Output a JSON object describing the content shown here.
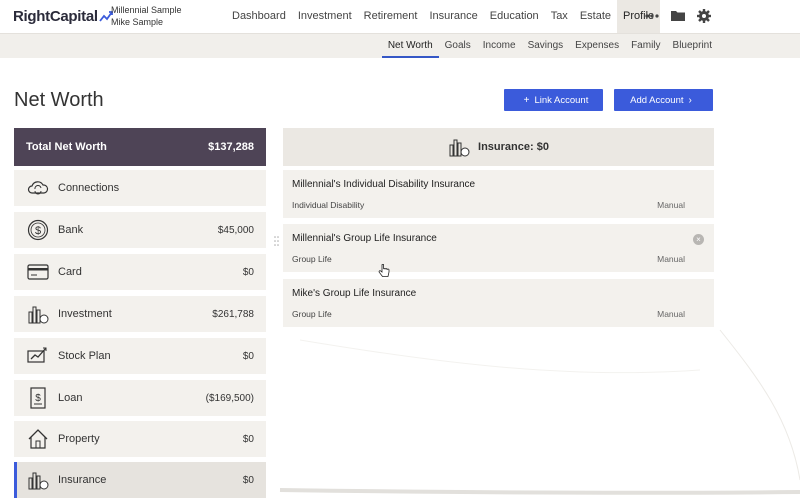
{
  "brand": {
    "name": "RightCapital",
    "accent": "#3b5bdb",
    "dark": "#4e4456"
  },
  "clients": {
    "line1": "Millennial Sample",
    "line2": "Mike Sample"
  },
  "main_nav": [
    "Dashboard",
    "Investment",
    "Retirement",
    "Insurance",
    "Education",
    "Tax",
    "Estate",
    "Profile"
  ],
  "main_nav_active": "Profile",
  "top_icons": [
    "more-icon",
    "folder-icon",
    "gear-icon"
  ],
  "sub_nav": [
    "Net Worth",
    "Goals",
    "Income",
    "Savings",
    "Expenses",
    "Family",
    "Blueprint"
  ],
  "sub_nav_active": "Net Worth",
  "page": {
    "title": "Net Worth",
    "link_account": "Link Account",
    "add_account": "Add Account"
  },
  "total": {
    "label": "Total Net Worth",
    "value": "$137,288"
  },
  "categories": [
    {
      "label": "Connections",
      "value": "",
      "icon": "cloud-sync-icon"
    },
    {
      "label": "Bank",
      "value": "$45,000",
      "icon": "dollar-coin-icon"
    },
    {
      "label": "Card",
      "value": "$0",
      "icon": "credit-card-icon"
    },
    {
      "label": "Investment",
      "value": "$261,788",
      "icon": "bar-chart-icon"
    },
    {
      "label": "Stock Plan",
      "value": "$0",
      "icon": "stock-plan-icon"
    },
    {
      "label": "Loan",
      "value": "($169,500)",
      "icon": "loan-document-icon"
    },
    {
      "label": "Property",
      "value": "$0",
      "icon": "house-icon"
    },
    {
      "label": "Insurance",
      "value": "$0",
      "icon": "insurance-chart-icon"
    }
  ],
  "insurance": {
    "header": "Insurance: $0",
    "policies": [
      {
        "name": "Millennial's Individual Disability Insurance",
        "type": "Individual Disability",
        "status": "Manual"
      },
      {
        "name": "Millennial's Group Life Insurance",
        "type": "Group Life",
        "status": "Manual"
      },
      {
        "name": "Mike's Group Life Insurance",
        "type": "Group Life",
        "status": "Manual"
      }
    ]
  }
}
